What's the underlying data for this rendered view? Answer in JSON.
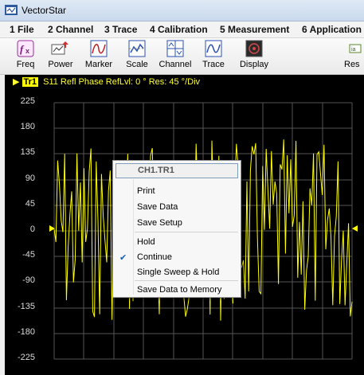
{
  "window": {
    "title": "VectorStar"
  },
  "menu": [
    "1 File",
    "2 Channel",
    "3 Trace",
    "4 Calibration",
    "5 Measurement",
    "6 Application"
  ],
  "toolbar": [
    {
      "label": "Freq",
      "icon": "freq-icon"
    },
    {
      "label": "Power",
      "icon": "power-icon"
    },
    {
      "label": "Marker",
      "icon": "marker-icon"
    },
    {
      "label": "Scale",
      "icon": "scale-icon"
    },
    {
      "label": "Channel",
      "icon": "channel-icon"
    },
    {
      "label": "Trace",
      "icon": "trace-icon"
    },
    {
      "label": "Display",
      "icon": "display-icon"
    },
    {
      "label": "Res",
      "icon": "response-icon"
    }
  ],
  "trace": {
    "badge": "Tr1",
    "header": "S11 Refl Phase RefLvl: 0 ° Res: 45 °/Div",
    "color": "#ffff00"
  },
  "y_ticks": [
    "225",
    "180",
    "135",
    "90",
    "45",
    "0",
    "-45",
    "-90",
    "-135",
    "-180",
    "-225"
  ],
  "context_menu": {
    "header": "CH1.TR1",
    "items": [
      {
        "label": "Print",
        "checked": false
      },
      {
        "label": "Save Data",
        "checked": false
      },
      {
        "label": "Save Setup",
        "checked": false
      },
      {
        "label": "Hold",
        "checked": false
      },
      {
        "label": "Continue",
        "checked": true
      },
      {
        "label": "Single Sweep & Hold",
        "checked": false
      },
      {
        "label": "Save Data to Memory",
        "checked": false
      }
    ]
  }
}
